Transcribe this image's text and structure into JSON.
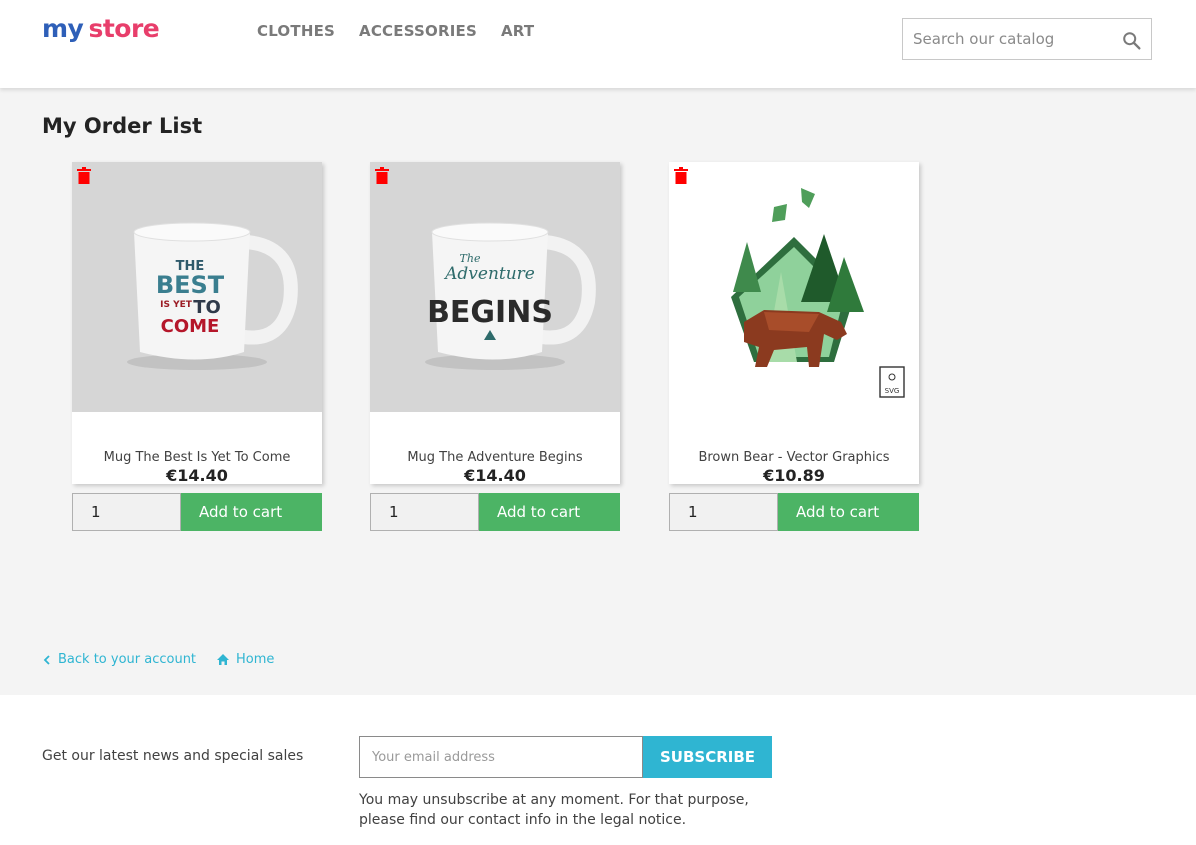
{
  "header": {
    "logo": {
      "part1": "my",
      "part2": "store"
    },
    "nav": [
      "CLOTHES",
      "ACCESSORIES",
      "ART"
    ],
    "search_placeholder": "Search our catalog"
  },
  "main": {
    "title": "My Order List",
    "products": [
      {
        "name": "Mug The Best Is Yet To Come",
        "price": "€14.40",
        "qty": "1",
        "button": "Add to cart",
        "mug_text": [
          "THE",
          "BEST",
          "IS YET",
          "TO",
          "COME"
        ]
      },
      {
        "name": "Mug The Adventure Begins",
        "price": "€14.40",
        "qty": "1",
        "button": "Add to cart",
        "mug_text": [
          "The",
          "Adventure",
          "BEGINS"
        ]
      },
      {
        "name": "Brown Bear - Vector Graphics",
        "price": "€10.89",
        "qty": "1",
        "button": "Add to cart",
        "badge": "SVG"
      }
    ],
    "links": {
      "back": "Back to your account",
      "home": "Home"
    }
  },
  "footer": {
    "newsletter_label": "Get our latest news and special sales",
    "email_placeholder": "Your email address",
    "subscribe": "SUBSCRIBE",
    "note": "You may unsubscribe at any moment. For that purpose, please find our contact info in the legal notice."
  },
  "colors": {
    "accent": "#2fb5d2",
    "cart_green": "#4cb465",
    "trash_red": "#ff0000",
    "background": "#f4f4f4"
  }
}
